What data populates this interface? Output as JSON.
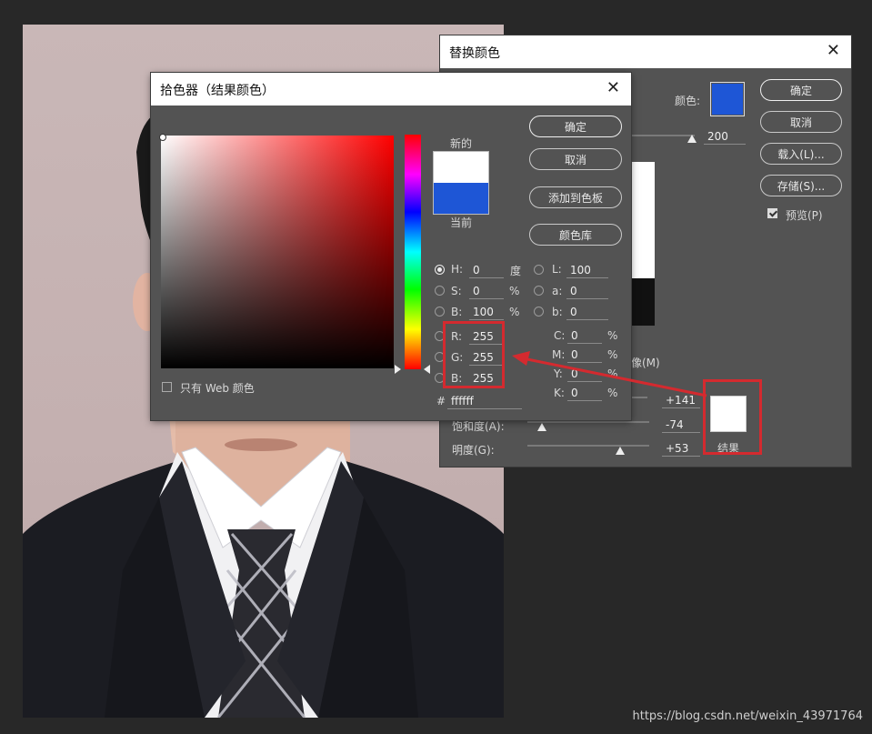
{
  "replace_dialog": {
    "title": "替换颜色",
    "color_label": "颜色:",
    "swatch_color": "#1e56d6",
    "fuzziness_value": "200",
    "image_option_fragment": "像(M)",
    "buttons": {
      "ok": "确定",
      "cancel": "取消",
      "load": "载入(L)...",
      "save": "存储(S)..."
    },
    "preview_label": "预览(P)",
    "hue_value": "+141",
    "saturation_label": "饱和度(A):",
    "saturation_value": "-74",
    "lightness_label": "明度(G):",
    "lightness_value": "+53",
    "result_label": "结果",
    "result_color": "#ffffff"
  },
  "picker_dialog": {
    "title": "拾色器（结果颜色）",
    "new_label": "新的",
    "current_label": "当前",
    "new_color": "#ffffff",
    "current_color": "#1e56d6",
    "buttons": {
      "ok": "确定",
      "cancel": "取消",
      "add_swatch": "添加到色板",
      "libraries": "颜色库"
    },
    "web_only_label": "只有 Web 颜色",
    "hsb": {
      "h_label": "H:",
      "h": "0",
      "h_unit": "度",
      "s_label": "S:",
      "s": "0",
      "s_unit": "%",
      "b_label": "B:",
      "b": "100",
      "b_unit": "%"
    },
    "lab": {
      "l_label": "L:",
      "l": "100",
      "a_label": "a:",
      "a": "0",
      "b_label": "b:",
      "b": "0"
    },
    "rgb": {
      "r_label": "R:",
      "r": "255",
      "g_label": "G:",
      "g": "255",
      "b_label": "B:",
      "b": "255"
    },
    "cmyk": {
      "c_label": "C:",
      "c": "0",
      "m_label": "M:",
      "m": "0",
      "y_label": "Y:",
      "y": "0",
      "k_label": "K:",
      "k": "0",
      "unit": "%"
    },
    "hex_label": "#",
    "hex": "ffffff"
  },
  "annotation_color": "#d42a2f",
  "watermark": "https://blog.csdn.net/weixin_43971764"
}
